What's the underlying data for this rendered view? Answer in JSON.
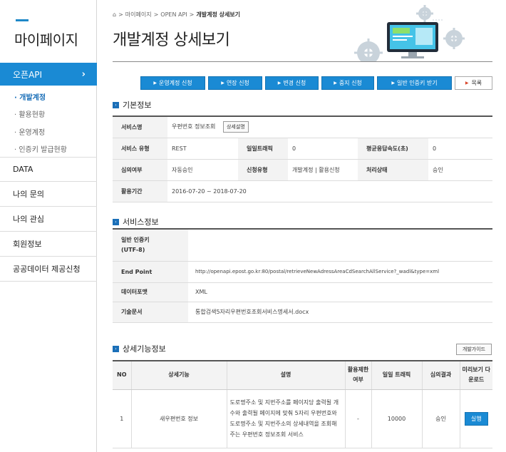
{
  "sidebar": {
    "title": "마이페이지",
    "active_menu": "오픈API",
    "sub_items": [
      "· 개발계정",
      "· 활용현황",
      "· 운영계정",
      "· 인증키 발급현황"
    ],
    "items": [
      "DATA",
      "나의 문의",
      "나의 관심",
      "회원정보",
      "공공데이터 제공신청"
    ]
  },
  "breadcrumb": {
    "items": [
      "마이페이지",
      "OPEN API"
    ],
    "current": "개발계정 상세보기",
    "separator": ">"
  },
  "page_title": "개발계정 상세보기",
  "actions": {
    "buttons": [
      "운영계정 신청",
      "연장 신청",
      "변경 신청",
      "중지 신청",
      "일반 인증키 받기"
    ],
    "list_label": "목록"
  },
  "basic_info": {
    "heading": "기본정보",
    "service_name_label": "서비스명",
    "service_name": "우편번호 정보조회",
    "detail_button": "상세설명",
    "service_type_label": "서비스 유형",
    "service_type": "REST",
    "daily_traffic_label": "일일트래픽",
    "daily_traffic": "0",
    "avg_speed_label": "평균응답속도(초)",
    "avg_speed": "0",
    "review_label": "심의여부",
    "review": "자동승인",
    "apply_type_label": "신청유형",
    "apply_type": "개발계정 | 활용신청",
    "status_label": "처리상태",
    "status": "승인",
    "period_label": "활용기간",
    "period": "2016-07-20 ~ 2018-07-20"
  },
  "service_info": {
    "heading": "서비스정보",
    "auth_key_label": "일반 인증키\n(UTF-8)",
    "auth_key": "",
    "endpoint_label": "End Point",
    "endpoint": "http://openapi.epost.go.kr:80/postal/retrieveNewAdressAreaCdSearchAllService?_wadl&type=xml",
    "format_label": "데이터포맷",
    "format": "XML",
    "doc_label": "기술문서",
    "doc": "통합검색5자리우편번호조회서비스명세서.docx"
  },
  "detail_features": {
    "heading": "상세기능정보",
    "guide_button": "개발가이드",
    "columns": [
      "NO",
      "상세기능",
      "설명",
      "활용제한 여부",
      "일일 트래픽",
      "심의결과",
      "미리보기 다운로드"
    ],
    "rows": [
      {
        "no": "1",
        "name": "새우편번호 정보",
        "desc": "도로명주소 및 지번주소를 페이지당 출력될 개수와 출력될 페이지에 맞춰 5자리 우편번호와 도로명주소 및 지번주소의 상세내역을 조회해주는 우편번호 정보조회 서비스",
        "limit": "-",
        "traffic": "10000",
        "result": "승인",
        "run_label": "실행"
      }
    ]
  },
  "colors": {
    "accent": "#1a8ad4",
    "marker": "#1a6fb8"
  }
}
